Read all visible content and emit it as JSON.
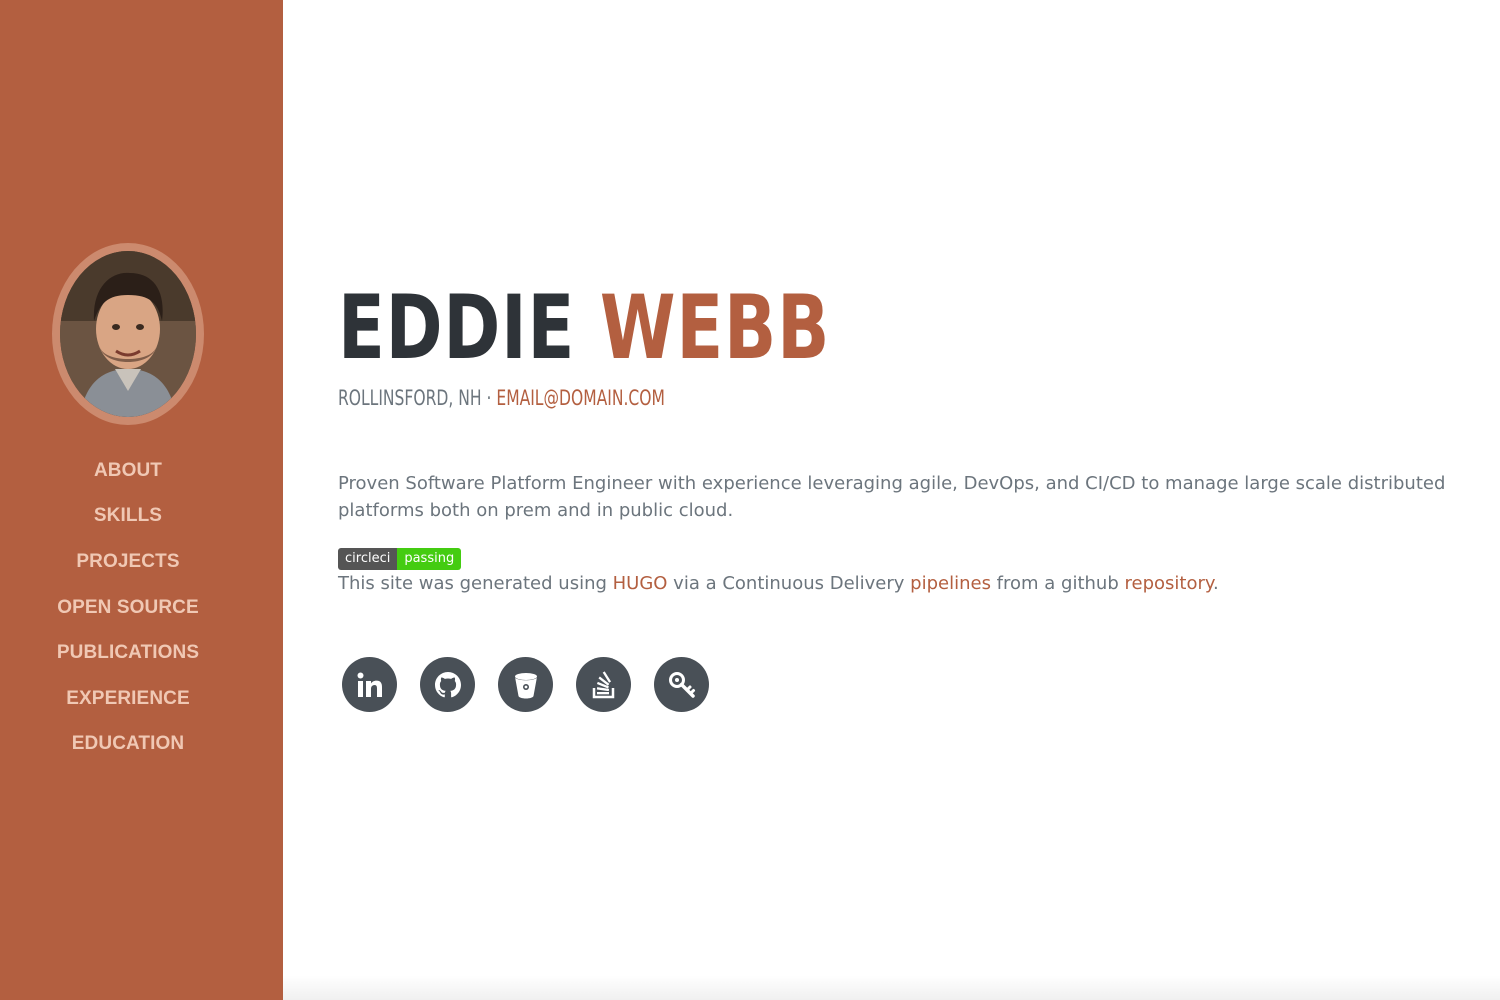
{
  "theme": {
    "primary": "#b35f40",
    "dark": "#2e3338",
    "muted": "#6c757d",
    "nav_link": "#f0c8b4",
    "icon_bg": "#495057"
  },
  "sidebar": {
    "items": [
      {
        "label": "ABOUT"
      },
      {
        "label": "SKILLS"
      },
      {
        "label": "PROJECTS"
      },
      {
        "label": "OPEN SOURCE"
      },
      {
        "label": "PUBLICATIONS"
      },
      {
        "label": "EXPERIENCE"
      },
      {
        "label": "EDUCATION"
      }
    ]
  },
  "about": {
    "first_name": "EDDIE",
    "last_name": "WEBB",
    "location": "ROLLINSFORD, NH",
    "separator": " · ",
    "email": "EMAIL@DOMAIN.COM",
    "bio": "Proven Software Platform Engineer with experience leveraging agile, DevOps, and CI/CD to manage large scale distributed platforms both on prem and in public cloud.",
    "badge": {
      "left": "circleci",
      "right": "passing"
    },
    "built": {
      "text1": "This site was generated using ",
      "link1": "HUGO",
      "text2": " via a Continuous Delivery ",
      "link2": "pipelines",
      "text3": " from a github ",
      "link3": "repository",
      "text4": "."
    }
  },
  "social": {
    "icons": [
      "linkedin-icon",
      "github-icon",
      "bitbucket-icon",
      "stackoverflow-icon",
      "keybase-icon"
    ]
  }
}
